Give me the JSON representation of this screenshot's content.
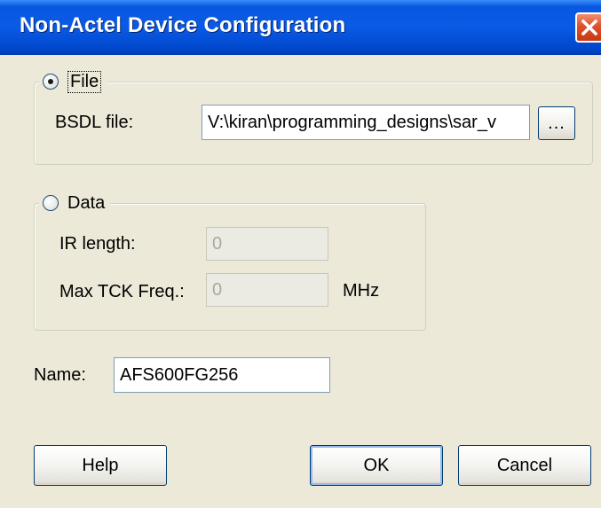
{
  "window": {
    "title": "Non-Actel Device Configuration"
  },
  "file_group": {
    "radio_label": "File",
    "selected": true,
    "bsdl_label": "BSDL file:",
    "bsdl_value": "V:\\kiran\\programming_designs\\sar_v",
    "browse_label": "..."
  },
  "data_group": {
    "radio_label": "Data",
    "selected": false,
    "ir_length_label": "IR length:",
    "ir_length_value": "0",
    "max_tck_label": "Max TCK Freq.:",
    "max_tck_value": "0",
    "max_tck_unit": "MHz"
  },
  "name_field": {
    "label": "Name:",
    "value": "AFS600FG256"
  },
  "buttons": {
    "help": "Help",
    "ok": "OK",
    "cancel": "Cancel"
  },
  "colors": {
    "titlebar": "#0a5ae6",
    "dialog_bg": "#ece9d8",
    "close_button": "#e0502a"
  },
  "icons": {
    "close": "close-icon"
  }
}
